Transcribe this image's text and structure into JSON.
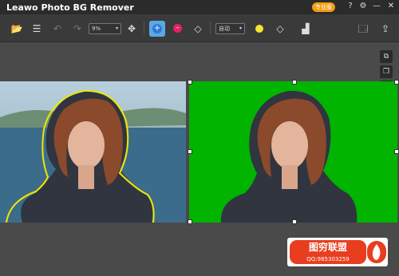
{
  "app": {
    "title": "Leawo Photo BG Remover",
    "pro_badge": "专业版"
  },
  "toolbar": {
    "zoom_value": "9%",
    "mode_value": "自动"
  },
  "watermark": {
    "line1": "图穷联盟",
    "line2": "QQ:985303259"
  },
  "colors": {
    "background_fill": "#00b400",
    "accent": "#5aa9e6",
    "brush_color": "#f7e534"
  }
}
